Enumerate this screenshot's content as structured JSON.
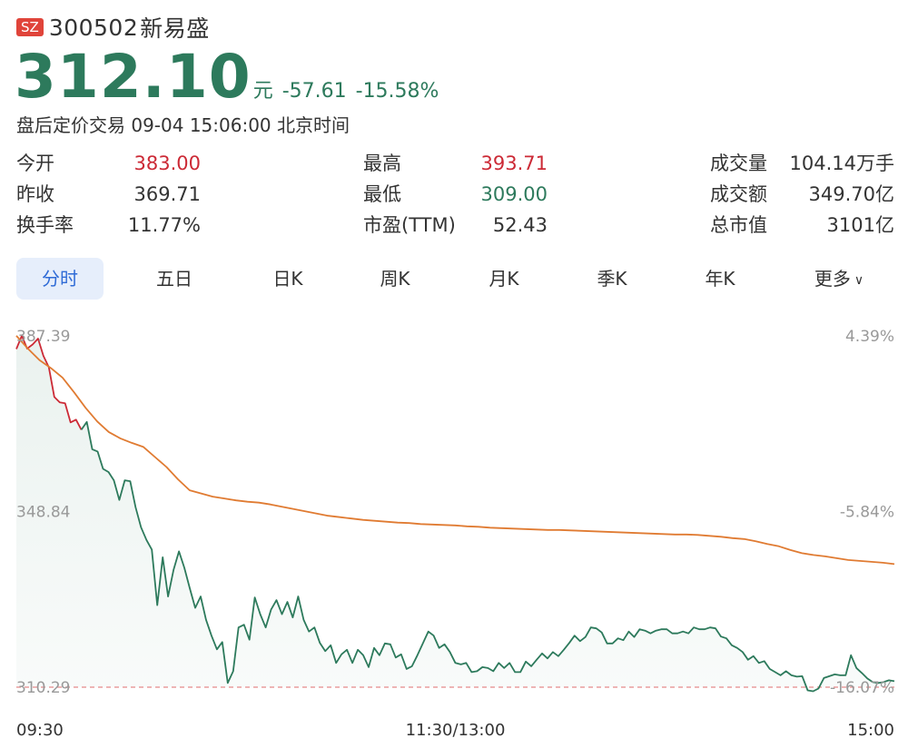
{
  "header": {
    "exchange_badge": "SZ",
    "code": "300502",
    "name": "新易盛",
    "price": "312.10",
    "unit": "元",
    "change": "-57.61",
    "change_pct": "-15.58%",
    "status": "盘后定价交易 09-04 15:06:00 北京时间"
  },
  "stats": [
    {
      "label": "今开",
      "value": "383.00",
      "tone": "red"
    },
    {
      "label": "最高",
      "value": "393.71",
      "tone": "red"
    },
    {
      "label": "成交量",
      "value": "104.14万手",
      "tone": "dark"
    },
    {
      "label": "昨收",
      "value": "369.71",
      "tone": "dark"
    },
    {
      "label": "最低",
      "value": "309.00",
      "tone": "green"
    },
    {
      "label": "成交额",
      "value": "349.70亿",
      "tone": "dark"
    },
    {
      "label": "换手率",
      "value": "11.77%",
      "tone": "dark"
    },
    {
      "label": "市盈(TTM)",
      "value": "52.43",
      "tone": "dark"
    },
    {
      "label": "总市值",
      "value": "3101亿",
      "tone": "dark"
    }
  ],
  "tabs": [
    {
      "label": "分时",
      "active": true
    },
    {
      "label": "五日",
      "active": false
    },
    {
      "label": "日K",
      "active": false
    },
    {
      "label": "周K",
      "active": false
    },
    {
      "label": "月K",
      "active": false
    },
    {
      "label": "季K",
      "active": false
    },
    {
      "label": "年K",
      "active": false
    },
    {
      "label": "更多",
      "active": false
    }
  ],
  "colors": {
    "price_line_up": "#cc2a36",
    "price_line_down": "#2d7a5c",
    "avg_line": "#e07b32",
    "prev_close_dashed": "#e58a8a",
    "fill": "#2d7a5c"
  },
  "chart_data": {
    "type": "line",
    "y_price_labels": [
      "387.39",
      "348.84",
      "310.29"
    ],
    "y_pct_labels": [
      "4.39%",
      "-5.84%",
      "-16.07%"
    ],
    "x_labels": [
      "09:30",
      "11:30/13:00",
      "15:00"
    ],
    "ylim": [
      310.29,
      387.39
    ],
    "reference_line": 310.29,
    "series": [
      {
        "values": [
          384.5,
          387.4,
          384.6,
          385.5,
          386.8,
          383.0,
          380.5,
          374.0,
          372.8,
          372.6,
          368.4,
          369.0,
          366.8,
          368.5,
          362.5,
          362.0,
          358.2,
          357.5,
          355.7,
          351.4,
          355.7,
          355.5,
          349.8,
          345.4,
          342.6,
          340.5,
          328.3,
          338.8,
          330.2,
          336.0,
          340.1,
          336.5,
          332.0,
          327.7,
          330.2,
          325.1,
          321.6,
          318.6,
          320.2,
          311.2,
          313.8,
          323.4,
          324.0,
          320.7,
          330.0,
          326.3,
          323.4,
          327.3,
          329.4,
          326.3,
          329.0,
          325.6,
          330.2,
          325.1,
          322.5,
          323.4,
          320.0,
          318.2,
          319.5,
          315.6,
          317.5,
          318.5,
          315.6,
          318.5,
          317.3,
          314.7,
          318.9,
          317.3,
          319.9,
          319.7,
          316.8,
          317.5,
          314.3,
          314.9,
          317.3,
          319.9,
          322.5,
          321.6,
          318.9,
          319.7,
          318.0,
          315.6,
          315.3,
          315.6,
          313.6,
          313.8,
          314.7,
          314.5,
          313.8,
          315.6,
          314.5,
          315.6,
          313.6,
          313.6,
          315.9,
          314.9,
          316.3,
          317.7,
          316.6,
          318.0,
          317.1,
          318.5,
          320.0,
          321.6,
          320.4,
          321.3,
          323.4,
          323.2,
          322.3,
          319.9,
          319.9,
          321.0,
          320.6,
          322.5,
          321.3,
          323.0,
          322.7,
          322.1,
          322.7,
          323.0,
          323.0,
          322.1,
          322.1,
          322.5,
          322.1,
          323.4,
          323.0,
          323.0,
          323.4,
          323.2,
          321.4,
          321.0,
          319.5,
          318.9,
          318.0,
          316.3,
          317.1,
          315.6,
          316.0,
          314.3,
          313.6,
          312.9,
          313.8,
          312.9,
          312.6,
          312.7,
          309.6,
          309.4,
          310.0,
          312.3,
          312.7,
          313.1,
          312.9,
          312.9,
          317.3,
          314.5,
          313.4,
          312.2,
          311.4,
          311.2,
          311.4,
          311.8,
          311.6
        ]
      },
      {
        "values": [
          387.4,
          384.6,
          382.1,
          380.3,
          378.2,
          375.0,
          371.6,
          368.6,
          366.3,
          364.9,
          363.9,
          363.0,
          360.8,
          358.6,
          355.9,
          353.5,
          352.8,
          352.1,
          351.7,
          351.3,
          351.0,
          350.8,
          350.4,
          349.9,
          349.4,
          348.9,
          348.4,
          347.9,
          347.6,
          347.3,
          347.0,
          346.8,
          346.6,
          346.4,
          346.3,
          346.1,
          346.0,
          345.9,
          345.8,
          345.6,
          345.5,
          345.3,
          345.2,
          345.1,
          345.0,
          344.9,
          344.8,
          344.8,
          344.7,
          344.6,
          344.5,
          344.4,
          344.3,
          344.2,
          344.1,
          344.0,
          343.9,
          343.8,
          343.8,
          343.7,
          343.5,
          343.3,
          343.0,
          342.8,
          342.3,
          341.7,
          341.2,
          340.4,
          339.7,
          339.3,
          339.0,
          338.6,
          338.2,
          338.0,
          337.8,
          337.6,
          337.3
        ]
      }
    ]
  }
}
